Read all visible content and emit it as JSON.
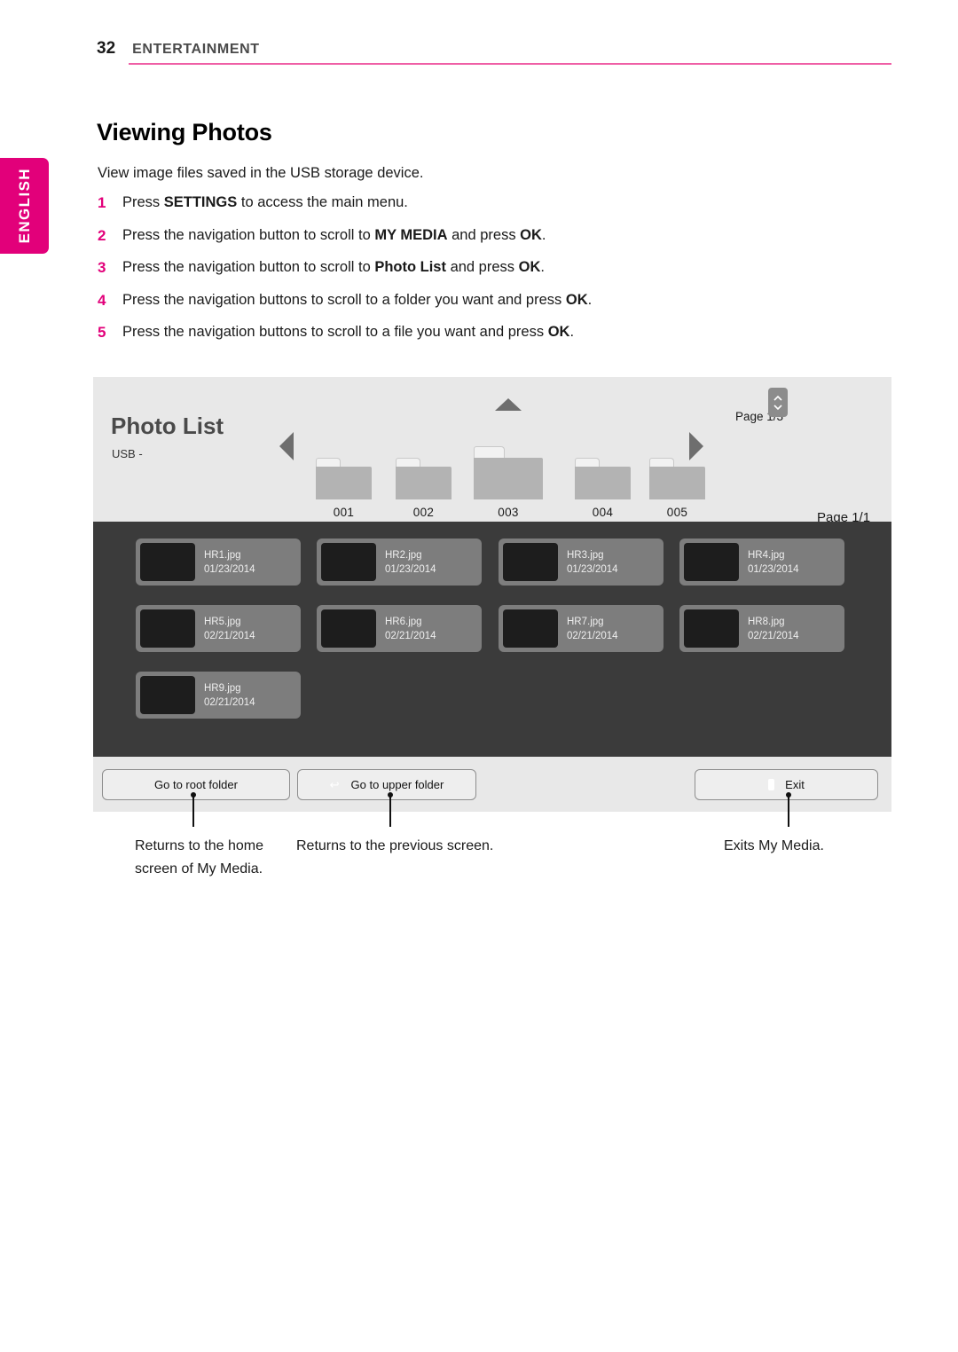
{
  "header": {
    "page_number": "32",
    "chapter": "ENTERTAINMENT",
    "rule_color": "#ef5fa6"
  },
  "side_tab": {
    "label": "ENGLISH",
    "color": "#e2007a"
  },
  "content": {
    "title": "Viewing Photos",
    "intro": "View image files saved in the USB storage device.",
    "steps": [
      {
        "num": "1",
        "pre": "Press ",
        "bold1": "SETTINGS",
        "mid": " to access the main menu.",
        "bold2": "",
        "post": ""
      },
      {
        "num": "2",
        "pre": "Press the navigation button to scroll to ",
        "bold1": "MY MEDIA",
        "mid": " and press ",
        "bold2": "OK",
        "post": "."
      },
      {
        "num": "3",
        "pre": "Press the navigation button to scroll to ",
        "bold1": "Photo List",
        "mid": " and press ",
        "bold2": "OK",
        "post": "."
      },
      {
        "num": "4",
        "pre": "Press the navigation buttons to scroll to a folder you want and press ",
        "bold1": "",
        "mid": "",
        "bold2": "OK",
        "post": "."
      },
      {
        "num": "5",
        "pre": "Press the navigation buttons to scroll to a file you want and press ",
        "bold1": "",
        "mid": "",
        "bold2": "OK",
        "post": "."
      }
    ]
  },
  "screenshot": {
    "title": "Photo List",
    "source_label": "USB -",
    "page_top": "Page 1/3",
    "page_bottom": "Page 1/1",
    "nav_left_icon": "arrow-left-icon",
    "nav_right_icon": "arrow-right-icon",
    "scroll_icon": "scroll-up-down-icon",
    "folders": [
      {
        "name": "001",
        "selected": false
      },
      {
        "name": "002",
        "selected": false
      },
      {
        "name": "003",
        "selected": true
      },
      {
        "name": "004",
        "selected": false
      },
      {
        "name": "005",
        "selected": false
      }
    ],
    "files": [
      {
        "name": "HR1.jpg",
        "date": "01/23/2014"
      },
      {
        "name": "HR2.jpg",
        "date": "01/23/2014"
      },
      {
        "name": "HR3.jpg",
        "date": "01/23/2014"
      },
      {
        "name": "HR4.jpg",
        "date": "01/23/2014"
      },
      {
        "name": "HR5.jpg",
        "date": "02/21/2014"
      },
      {
        "name": "HR6.jpg",
        "date": "02/21/2014"
      },
      {
        "name": "HR7.jpg",
        "date": "02/21/2014"
      },
      {
        "name": "HR8.jpg",
        "date": "02/21/2014"
      },
      {
        "name": "HR9.jpg",
        "date": "02/21/2014"
      }
    ],
    "buttons": {
      "root": "Go to root folder",
      "upper": "Go to upper folder",
      "upper_icon": "return-arrow-icon",
      "exit": "Exit",
      "exit_icon": "exit-block-icon"
    }
  },
  "callouts": {
    "root": "Returns to the home screen of My Media.",
    "upper": "Returns to the previous screen.",
    "exit": "Exits My Media."
  }
}
